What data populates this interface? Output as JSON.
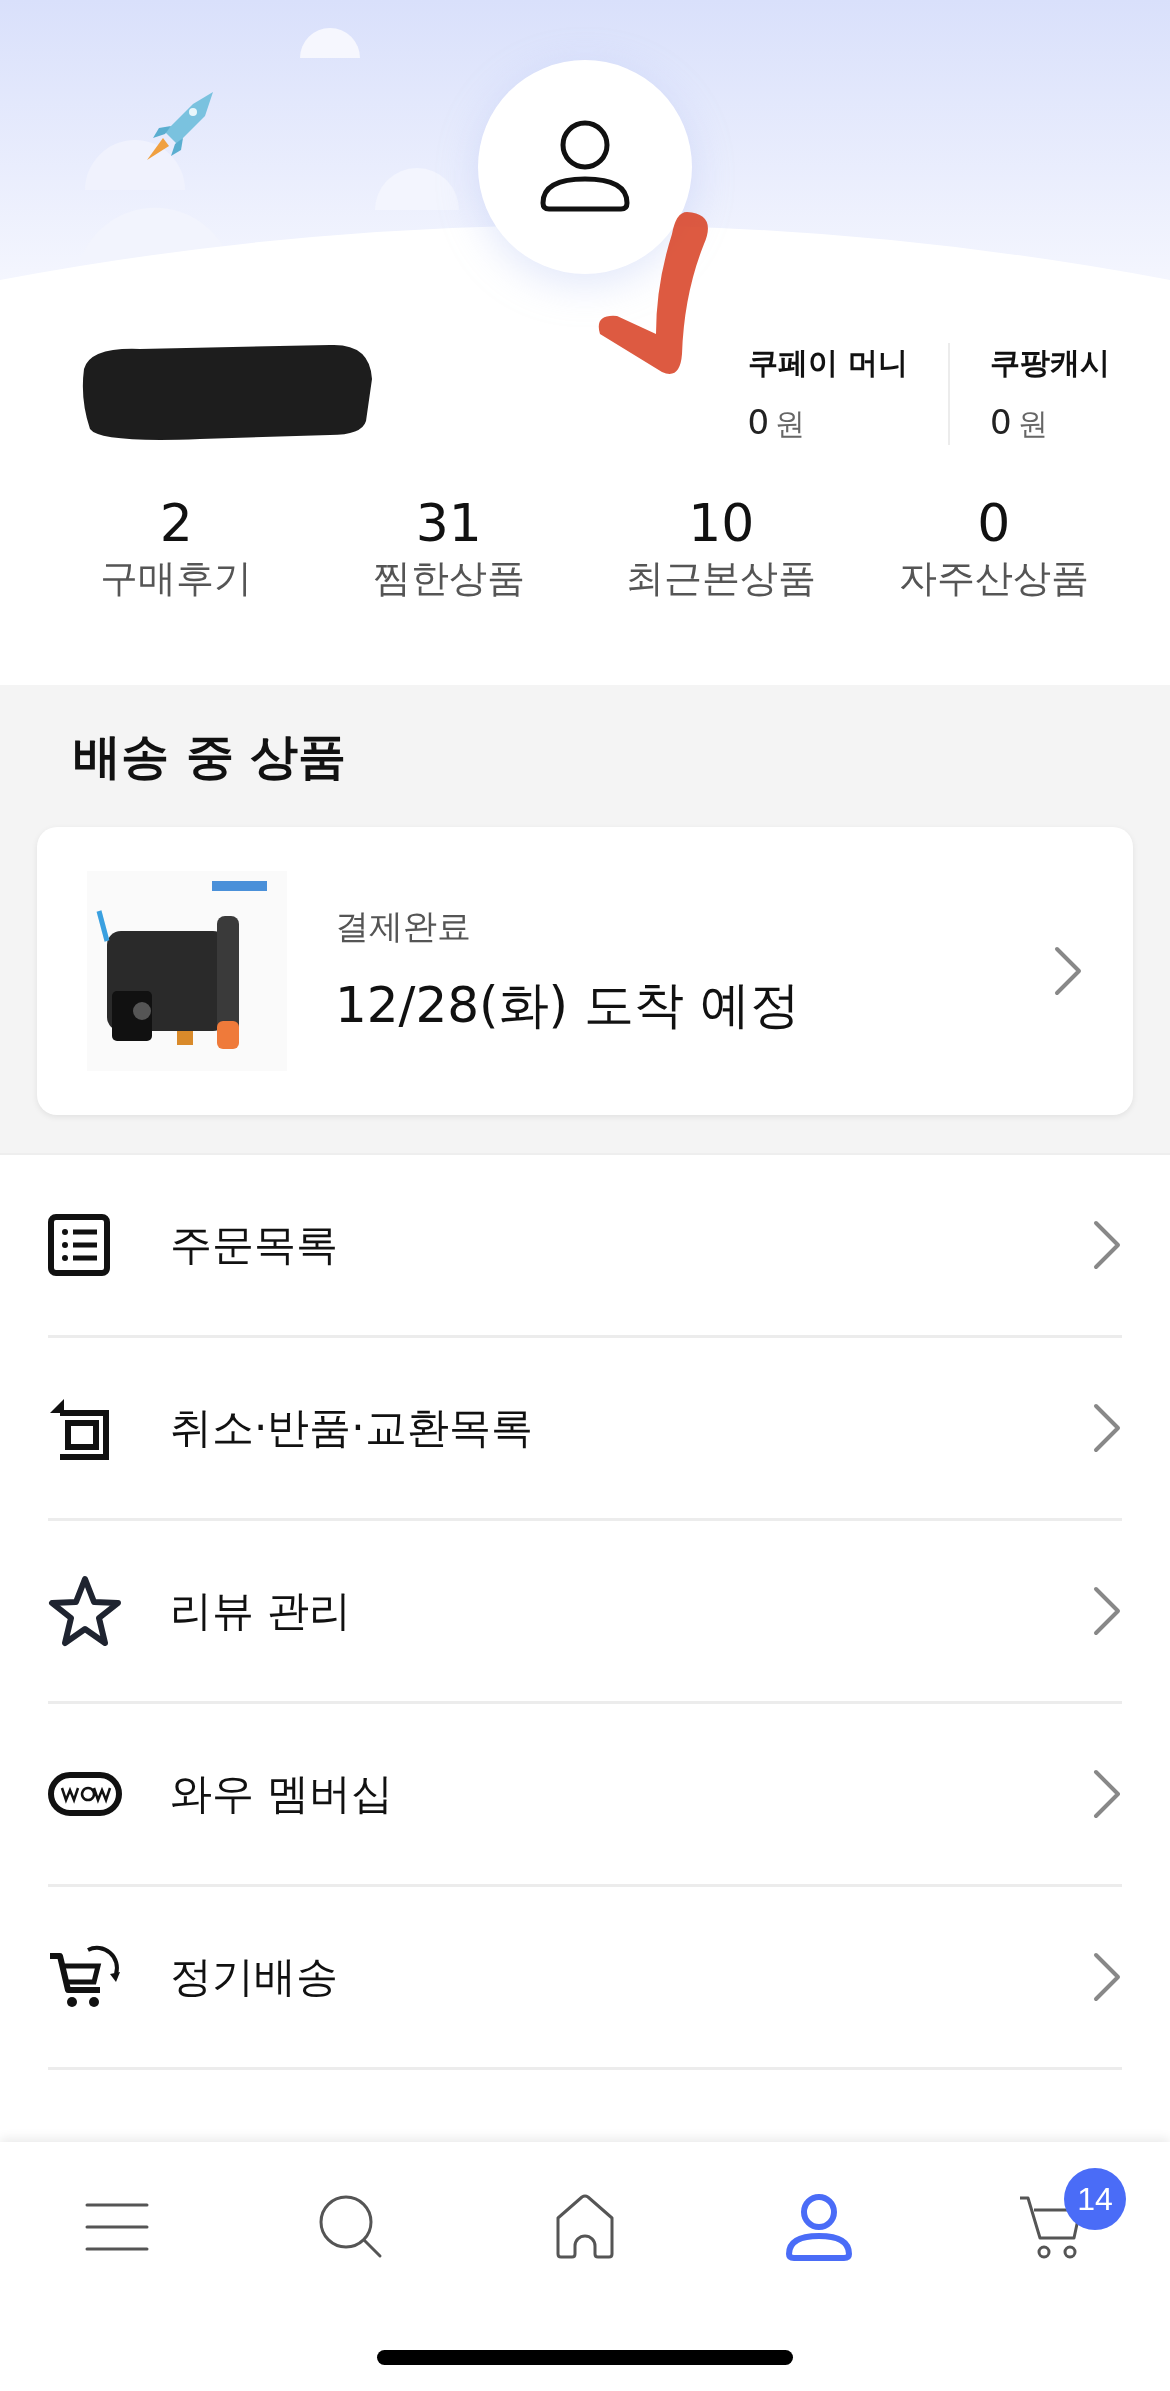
{
  "wallet": [
    {
      "label": "쿠페이 머니",
      "amount": "0",
      "unit": "원"
    },
    {
      "label": "쿠팡캐시",
      "amount": "0",
      "unit": "원"
    }
  ],
  "stats": [
    {
      "count": "2",
      "label": "구매후기"
    },
    {
      "count": "31",
      "label": "찜한상품"
    },
    {
      "count": "10",
      "label": "최근본상품"
    },
    {
      "count": "0",
      "label": "자주산상품"
    }
  ],
  "delivery": {
    "title": "배송 중 상품",
    "status": "결제완료",
    "eta": "12/28(화) 도착 예정"
  },
  "menu": [
    {
      "label": "주문목록"
    },
    {
      "label": "취소·반품·교환목록"
    },
    {
      "label": "리뷰 관리"
    },
    {
      "label": "와우 멤버십"
    },
    {
      "label": "정기배송"
    }
  ],
  "nav": [
    {
      "selected": false
    },
    {
      "selected": false
    },
    {
      "selected": false
    },
    {
      "selected": true
    },
    {
      "selected": false,
      "badge": "14"
    }
  ]
}
